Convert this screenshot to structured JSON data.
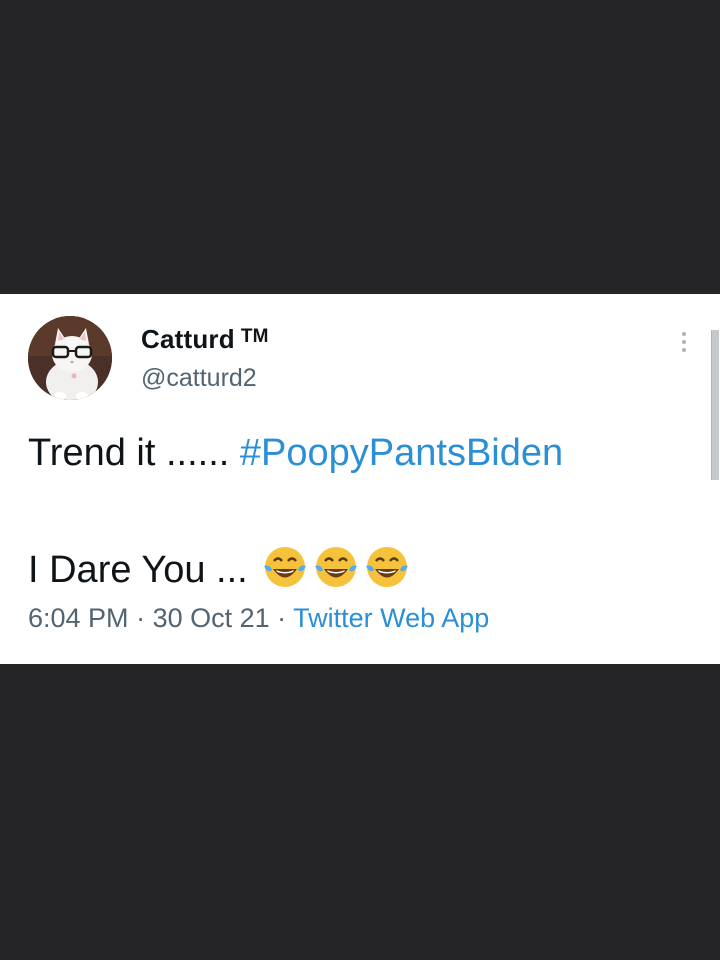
{
  "author": {
    "display_name": "Catturd",
    "trademark": "TM",
    "handle": "@catturd2"
  },
  "tweet": {
    "line1_text": "Trend it ...... ",
    "hashtag": "#PoopyPantsBiden",
    "line2_text": "I Dare You ... ",
    "emojis": [
      "face-with-tears-of-joy-icon",
      "face-with-tears-of-joy-icon",
      "face-with-tears-of-joy-icon"
    ]
  },
  "meta": {
    "time": "6:04 PM",
    "separator1": " · ",
    "date": "30 Oct 21",
    "separator2": " · ",
    "source": "Twitter Web App"
  },
  "colors": {
    "background": "#252527",
    "card": "#ffffff",
    "link": "#2a8fd4",
    "text": "#0f1419",
    "muted": "#536471",
    "emoji_face": "#f5c33b"
  }
}
